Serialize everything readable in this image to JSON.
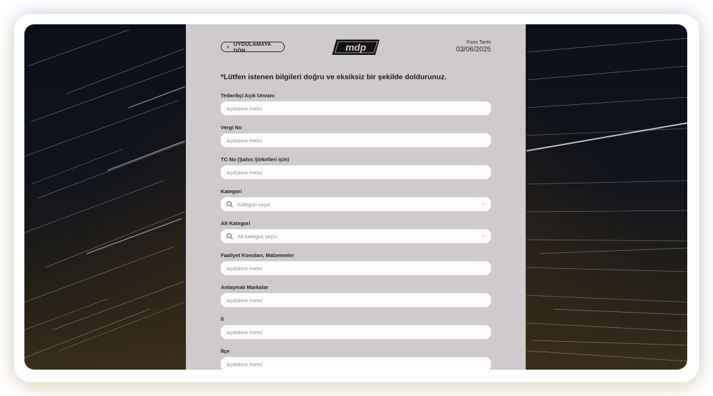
{
  "header": {
    "back_label": "UYGULAMAYA DÖN",
    "logo_text": "mdp",
    "date_label": "Form Tarihi",
    "date_value": "03/06/2025"
  },
  "note": "*Lütfen istenen bilgileri doğru ve eksiksiz bir şekilde doldurunuz.",
  "fields": [
    {
      "label": "Tedarikçi Açık Unvanı",
      "placeholder": "Açıklama metni"
    },
    {
      "label": "Vergi No",
      "placeholder": "Açıklama metni"
    },
    {
      "label": "TC No (Şahıs Şirketleri için)",
      "placeholder": "Açıklama metni"
    },
    {
      "label": "Kategori",
      "placeholder": "Kategori seçin"
    },
    {
      "label": "Alt Kategori",
      "placeholder": "Alt kategori seçin"
    },
    {
      "label": "Faaliyet Konuları, Malzemeler",
      "placeholder": "Açıklama metni"
    },
    {
      "label": "Anlaşmalı Markalar",
      "placeholder": "Açıklama metni"
    },
    {
      "label": "İl",
      "placeholder": "Açıklama metni"
    },
    {
      "label": "İlçe",
      "placeholder": "Açıklama metni"
    }
  ],
  "icons": {
    "back": "chevron-left-icon",
    "search": "search-icon",
    "dropdown": "chevron-down-icon"
  },
  "colors": {
    "panel": "#cfcacb",
    "input_bg": "#fdfdfd",
    "text": "#1f1f1f"
  }
}
